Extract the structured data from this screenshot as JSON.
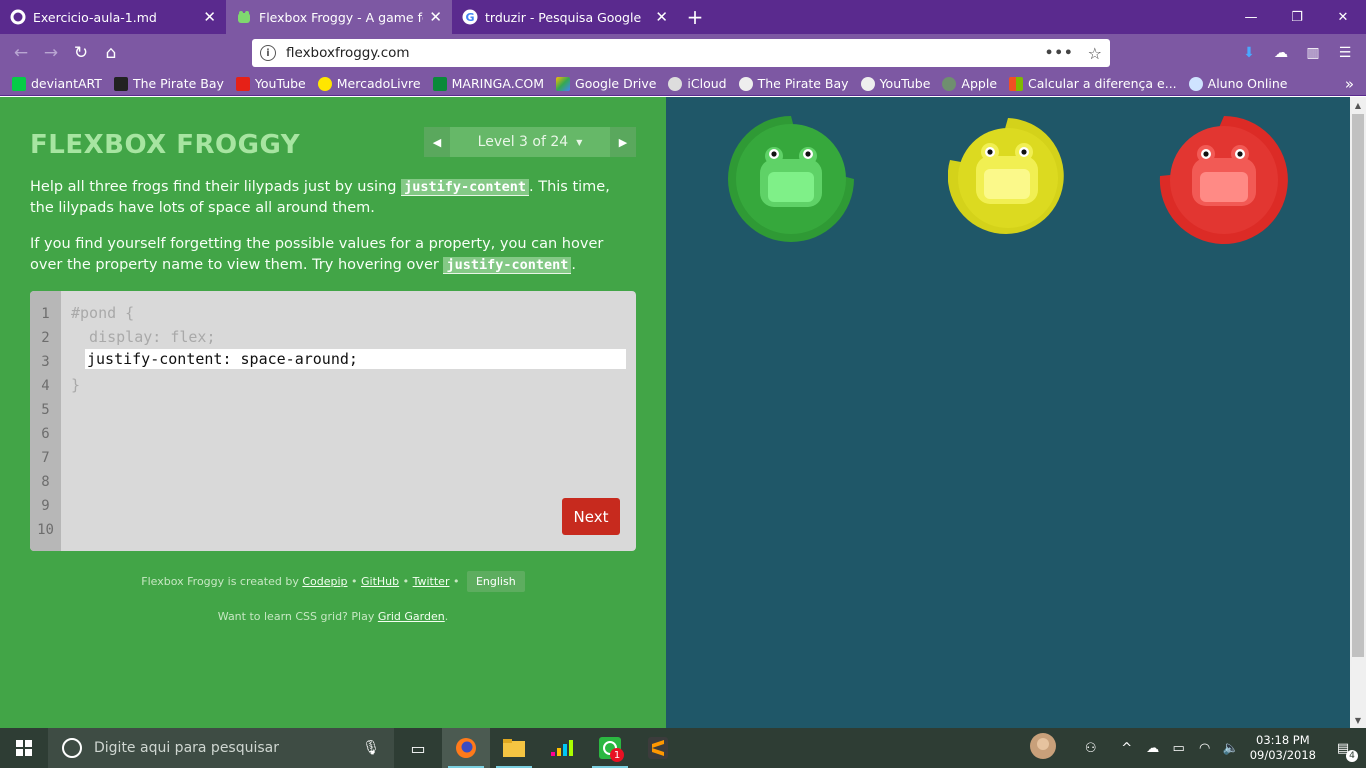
{
  "browser": {
    "tabs": [
      {
        "title": "Exercicio-aula-1.md",
        "active": false
      },
      {
        "title": "Flexbox Froggy - A game for lea",
        "active": true
      },
      {
        "title": "trduzir - Pesquisa Google",
        "active": false
      }
    ],
    "url": "flexboxfroggy.com",
    "bookmarks": [
      "deviantART",
      "The Pirate Bay",
      "YouTube",
      "MercadoLivre",
      "MARINGA.COM",
      "Google Drive",
      "iCloud",
      "The Pirate Bay",
      "YouTube",
      "Apple",
      "Calcular a diferença e...",
      "Aluno Online"
    ]
  },
  "game": {
    "title": "FLEXBOX FROGGY",
    "level": "Level 3 of 24",
    "instructions_1": {
      "pre": "Help all three frogs find their lilypads just by using ",
      "code": "justify-content",
      "post": ". This time, the lilypads have lots of space all around them."
    },
    "instructions_2": {
      "pre": "If you find yourself forgetting the possible values for a property, you can hover over the property name to view them. Try hovering over ",
      "code": "justify-content",
      "post": "."
    },
    "line_numbers": [
      "1",
      "2",
      "3",
      "4",
      "5",
      "6",
      "7",
      "8",
      "9",
      "10"
    ],
    "code_line_1": "#pond {",
    "code_line_2": "  display: flex;",
    "answer": "justify-content: space-around;",
    "code_line_4": "}",
    "next_label": "Next",
    "credits": {
      "pre": "Flexbox Froggy is created by",
      "codepip": "Codepip",
      "github": "GitHub",
      "twitter": "Twitter",
      "language": "English"
    },
    "grid": {
      "pre": "Want to learn CSS grid? Play",
      "link": "Grid Garden",
      "post": "."
    },
    "frogs": [
      "green",
      "yellow",
      "red"
    ]
  },
  "colors": {
    "left_bg": "#42a547",
    "pond_bg": "#1f5768",
    "green": "#2f9a35",
    "yellow": "#d4d21a",
    "red": "#dc2b26"
  },
  "taskbar": {
    "search_placeholder": "Digite aqui para pesquisar",
    "time": "03:18 PM",
    "date": "09/03/2018",
    "whatsapp_badge": "1",
    "notifications": "4"
  }
}
